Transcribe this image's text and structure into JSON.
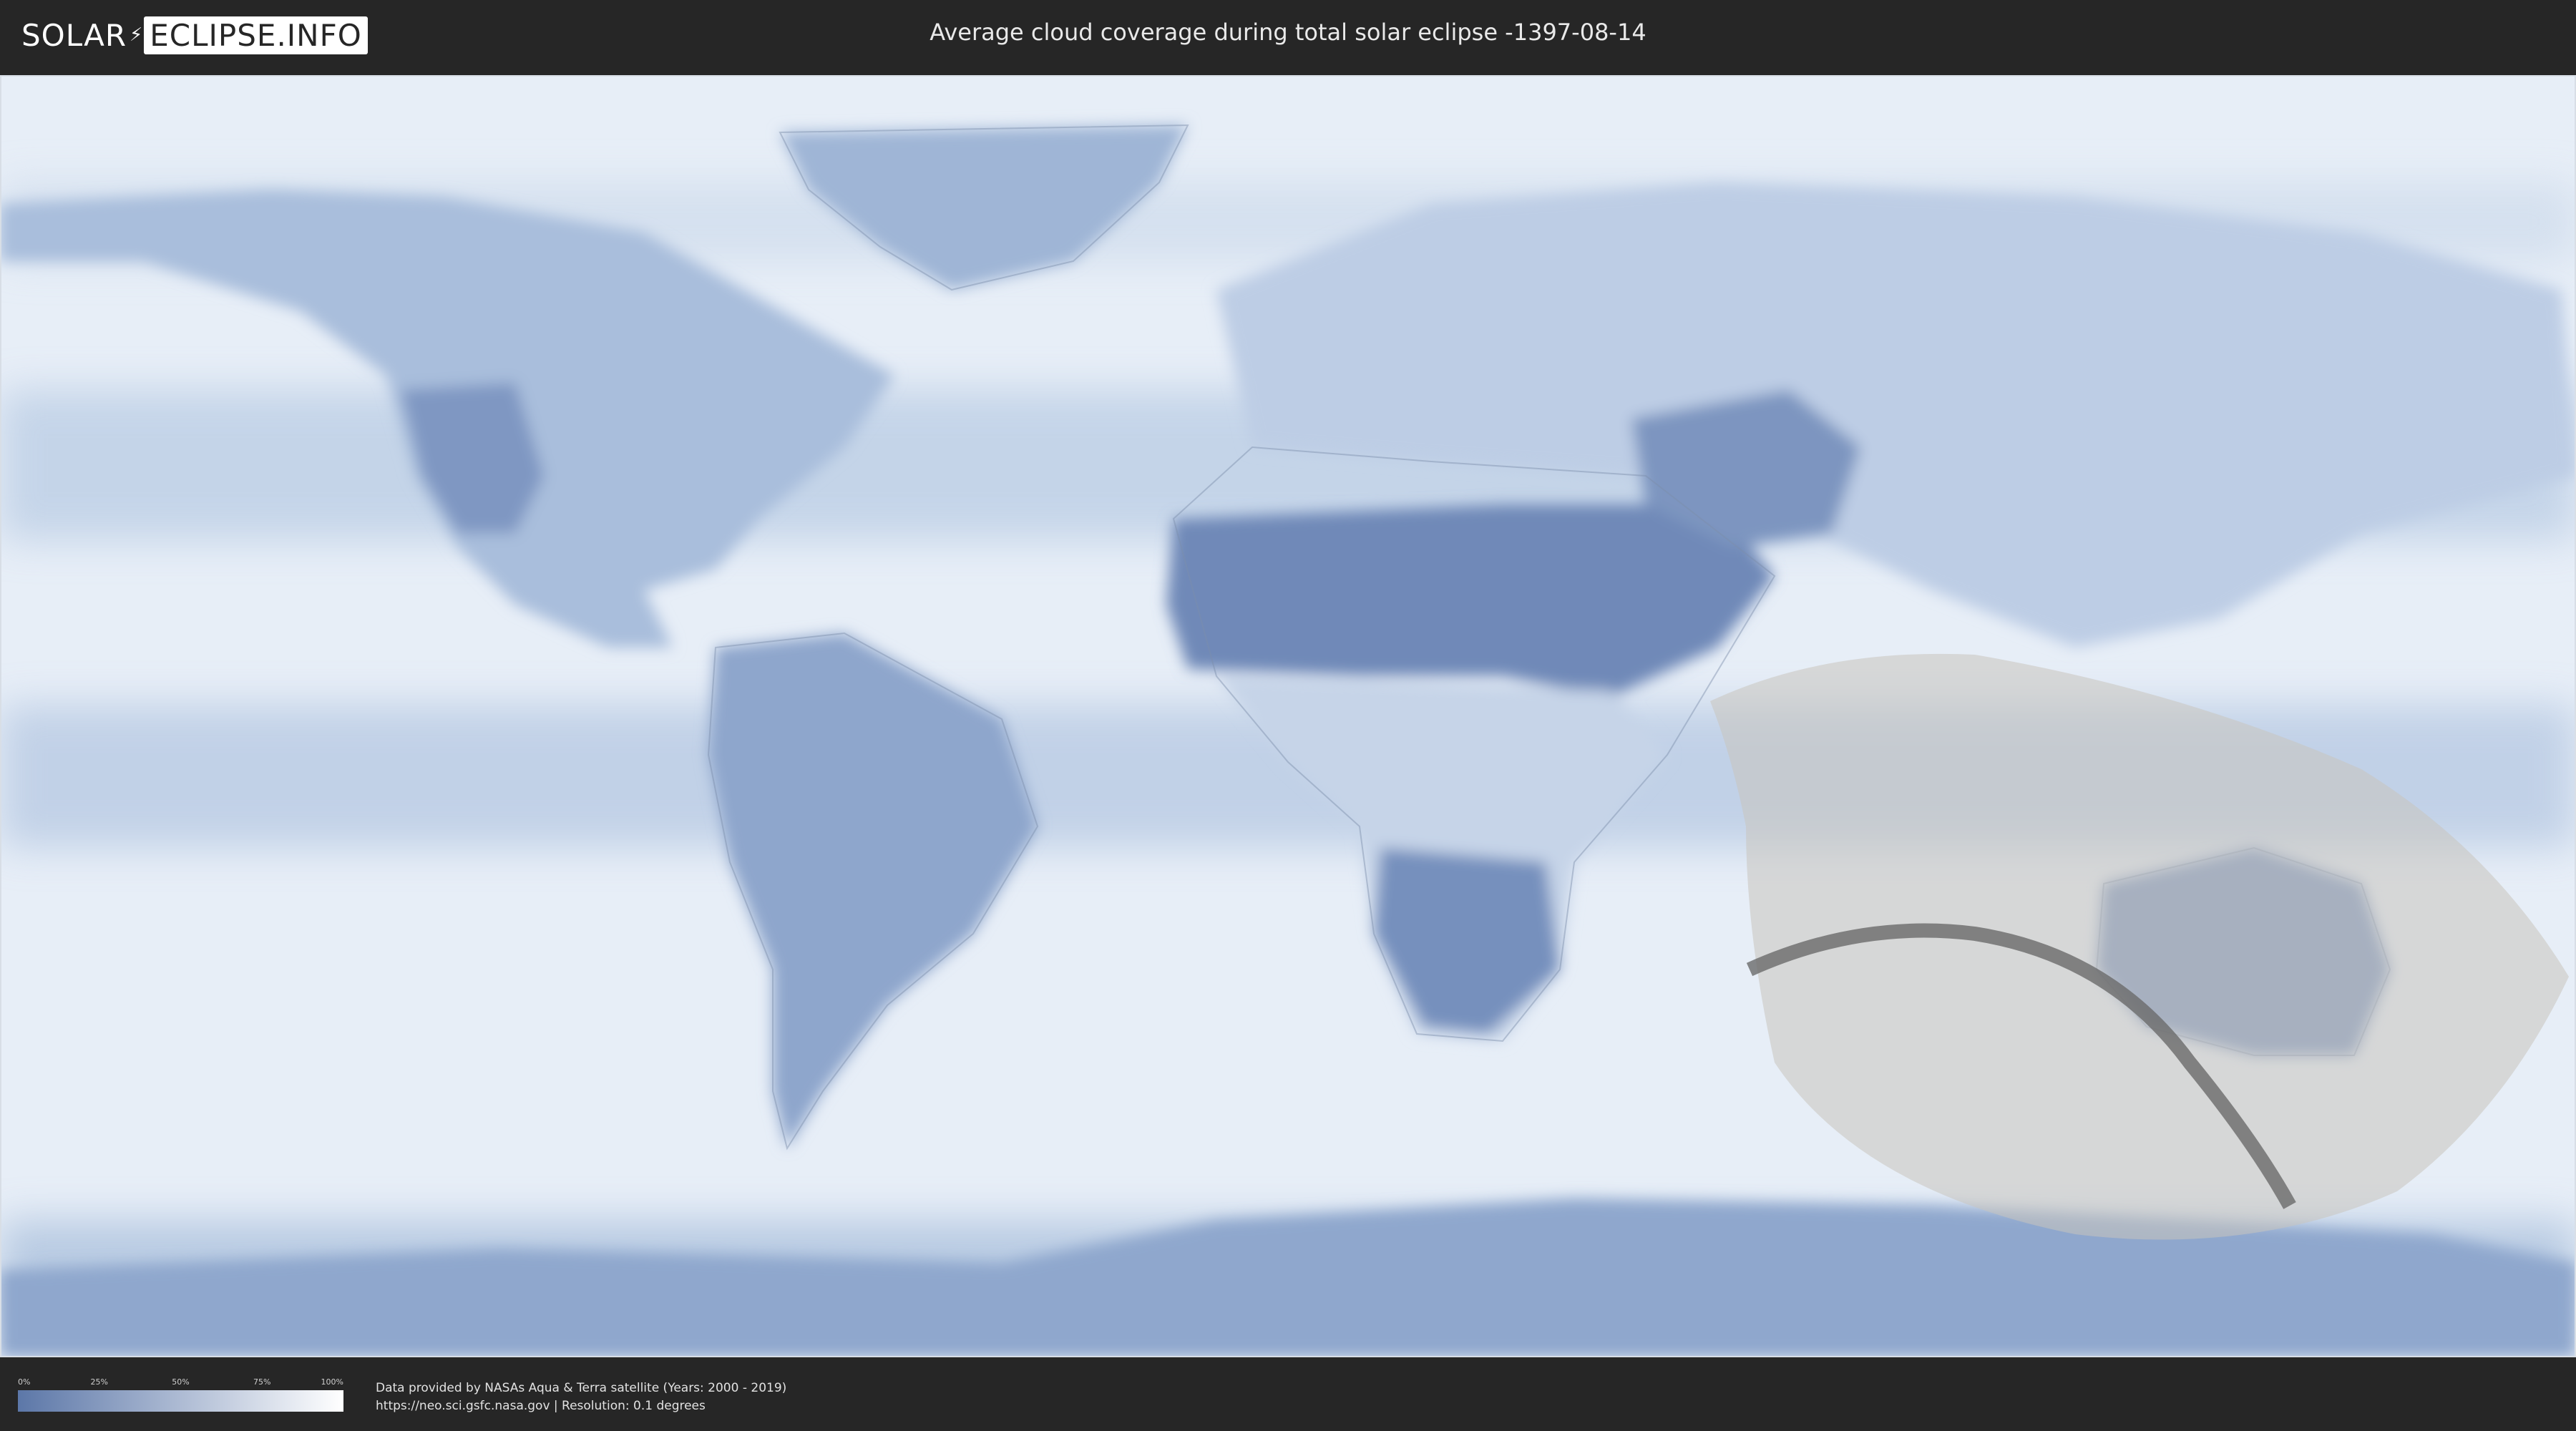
{
  "header": {
    "logo_left": "SOLAR",
    "logo_right": "ECLIPSE.INFO",
    "title": "Average cloud coverage during total solar eclipse -1397-08-14"
  },
  "legend": {
    "ticks": [
      "0%",
      "25%",
      "50%",
      "75%",
      "100%"
    ],
    "color_low": "#5c77a8",
    "color_high": "#ffffff"
  },
  "credits": {
    "line1": "Data provided by NASAs Aqua & Terra satellite (Years: 2000 - 2019)",
    "line2": "https://neo.sci.gsfc.nasa.gov | Resolution: 0.1 degrees"
  },
  "colors": {
    "background": "#262626",
    "ocean_cloud": "#dfe8f3",
    "clear_land": "#6d87b6",
    "eclipse_overlay": "#c9c4bd",
    "path_of_totality": "#6a6a6a"
  }
}
